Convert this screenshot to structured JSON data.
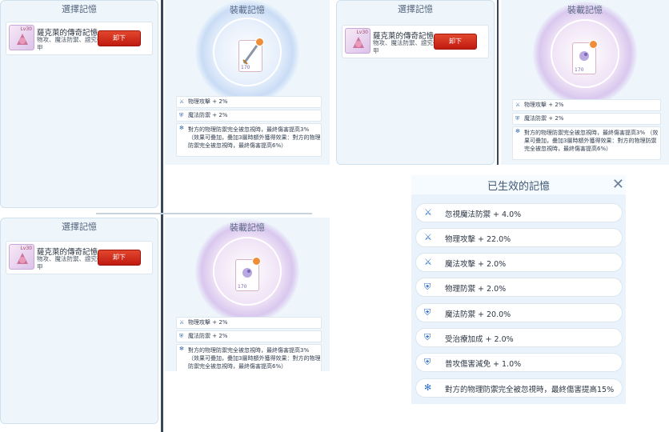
{
  "select_panels": [
    {
      "title": "選擇記憶",
      "card": {
        "name": "薩克萊的傳奇記憶",
        "desc": "物攻、魔法防禦、誼究破甲",
        "level": "Lv30",
        "button": "卸下"
      }
    },
    {
      "title": "選擇記憶",
      "card": {
        "name": "薩克萊的傳奇記憶",
        "desc": "物攻、魔法防禦、誼究破甲",
        "level": "Lv30",
        "button": "卸下"
      }
    },
    {
      "title": "選擇記憶",
      "card": {
        "name": "薩克萊的傳奇記憶",
        "desc": "物攻、魔法防禦、誼究破甲",
        "level": "Lv30",
        "button": "卸下"
      }
    }
  ],
  "equip_panels": [
    {
      "title": "裝載記憶",
      "level": "170",
      "stats": [
        "物理攻擊 + 2%",
        "魔法防禦 + 2%"
      ],
      "effect": "對方的物理防禦完全被忽視時，最終傷害提高3% （效果可疊加，疊加3層時額外獲得效果：對方的物理防禦完全被忽視時，最終傷害提高6%）"
    },
    {
      "title": "裝載記憶",
      "level": "170",
      "stats": [
        "物理攻擊 + 2%",
        "魔法防禦 + 2%"
      ],
      "effect": "對方的物理防禦完全被忽視時，最終傷害提高3% （效果可疊加，疊加3層時額外獲得效果：對方的物理防禦完全被忽視時，最終傷害提高6%）"
    },
    {
      "title": "裝載記憶",
      "level": "170",
      "stats": [
        "物理攻擊 + 2%",
        "魔法防禦 + 2%"
      ],
      "effect": "對方的物理防禦完全被忽視時，最終傷害提高3% （效果可疊加，疊加3層時額外獲得效果：對方的物理防禦完全被忽視時，最終傷害提高6%）"
    }
  ],
  "active": {
    "title": "已生效的記憶",
    "close": "✕",
    "rows": [
      {
        "icon": "sword-icon",
        "text": "忽視魔法防禦 + 4.0%"
      },
      {
        "icon": "sword-icon",
        "text": "物理攻擊 + 22.0%"
      },
      {
        "icon": "sword-icon",
        "text": "魔法攻擊 + 2.0%"
      },
      {
        "icon": "shield-icon",
        "text": "物理防禦 + 2.0%"
      },
      {
        "icon": "shield-icon",
        "text": "魔法防禦 + 20.0%"
      },
      {
        "icon": "shield-icon",
        "text": "受治療加成 + 2.0%"
      },
      {
        "icon": "shield-icon",
        "text": "普攻傷害減免 + 1.0%"
      },
      {
        "icon": "snowflake-icon",
        "text": "對方的物理防禦完全被忽視時，最終傷害提高15%"
      }
    ]
  },
  "colors": {
    "button_red": "#d42b1c",
    "panel_bg": "#eef6fc",
    "accent_blue": "#2f6fc4"
  }
}
